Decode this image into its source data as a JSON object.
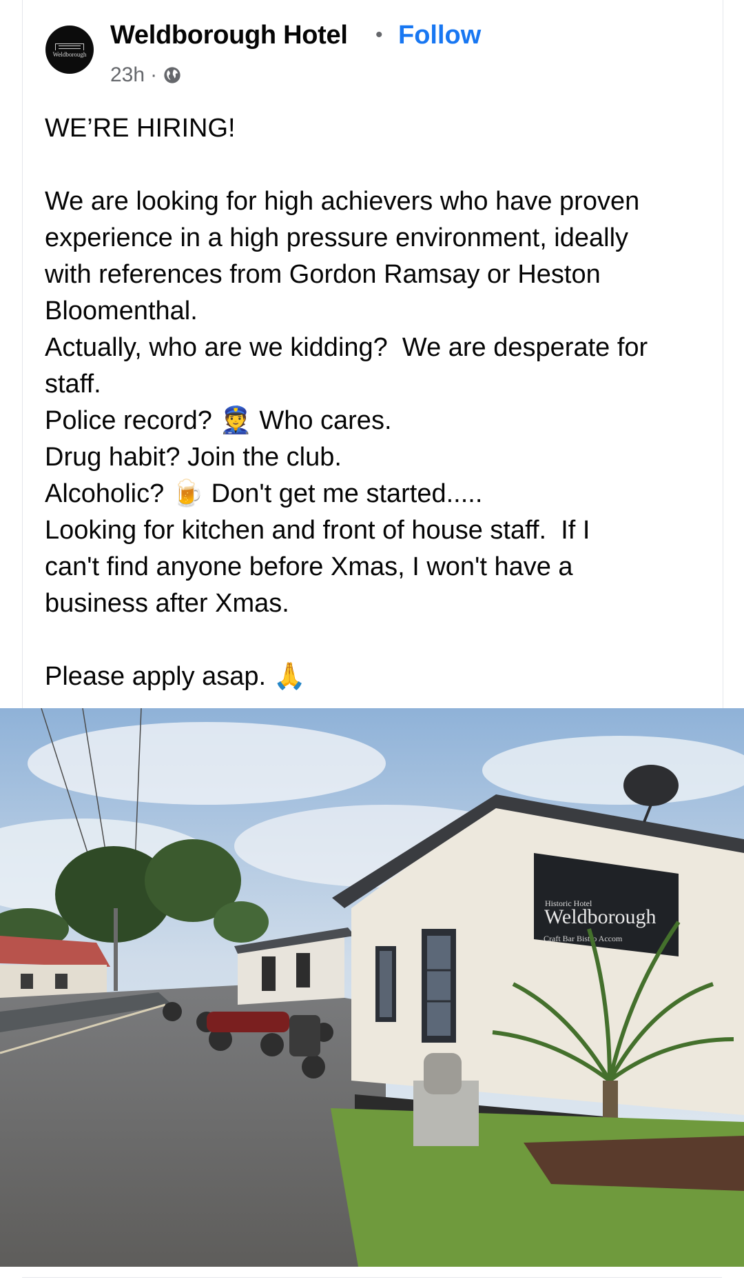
{
  "post": {
    "author": "Weldborough Hotel",
    "avatar_logo_text": "Weldborough",
    "separator": "•",
    "follow_label": "Follow",
    "time": "23h",
    "time_separator": "·",
    "audience_icon": "globe-icon",
    "text_lines": [
      "WE’RE HIRING!",
      "",
      "We are looking for high achievers who have proven",
      "experience in a high pressure environment, ideally",
      "with references from Gordon Ramsay or Heston",
      "Bloomenthal.",
      "Actually, who are we kidding?  We are desperate for",
      "staff.",
      "Police record? 👮 Who cares.",
      "Drug habit? Join the club.",
      "Alcoholic? 🍺 Don't get me started.....",
      "Looking for kitchen and front of house staff.  If I",
      "can't find anyone before Xmas, I won't have a",
      "business after Xmas.",
      "",
      "Please apply asap. 🙏"
    ]
  },
  "photo": {
    "sign_small": "Historic Hotel",
    "sign_main": "Weldborough",
    "sign_sub": "Craft Bar   Bistro   Accom"
  },
  "colors": {
    "link": "#1877f2",
    "secondary_text": "#65676b",
    "border": "#e4e6eb"
  }
}
